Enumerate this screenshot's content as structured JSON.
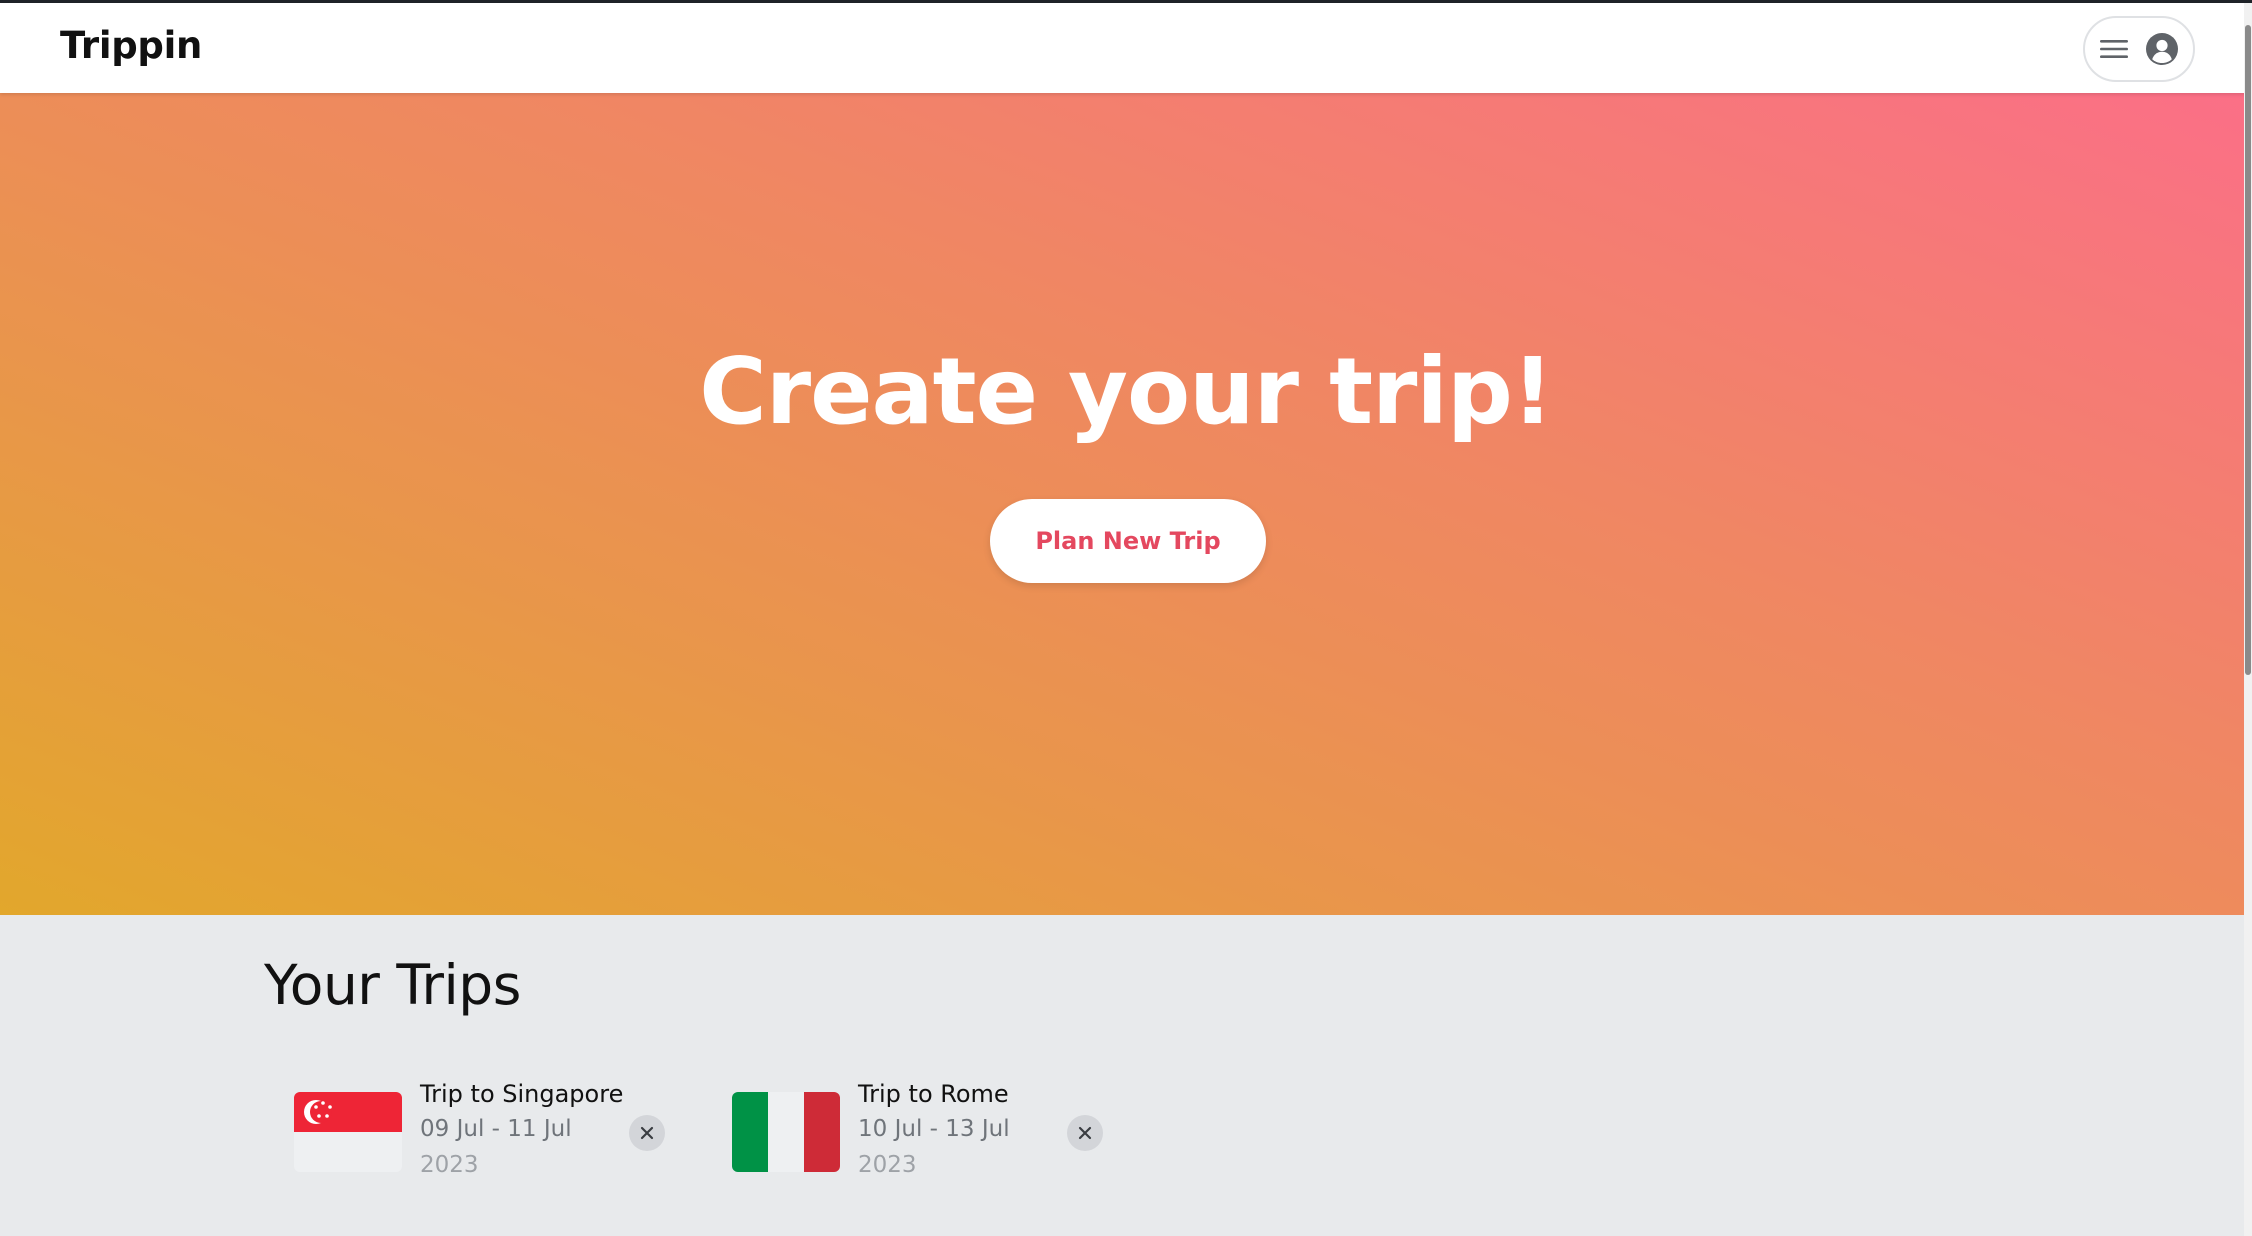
{
  "app": {
    "logo": "Trippin"
  },
  "navbar": {
    "menu_icon": "hamburger-menu-icon",
    "user_icon": "user-circle-icon"
  },
  "hero": {
    "title": "Create your trip!",
    "button_label": "Plan New Trip",
    "button_color": "#e4485f",
    "gradient": [
      "#e2a72c",
      "#e9954c",
      "#f08664",
      "#fb6f87"
    ]
  },
  "trips": {
    "heading": "Your Trips",
    "items": [
      {
        "title": "Trip to Singapore",
        "dates": "09 Jul - 11 Jul",
        "year": "2023",
        "flag_icon": "singapore-flag-icon",
        "remove_icon": "close-icon"
      },
      {
        "title": "Trip to Rome",
        "dates": "10 Jul - 13 Jul",
        "year": "2023",
        "flag_icon": "italy-flag-icon",
        "remove_icon": "close-icon"
      }
    ]
  }
}
